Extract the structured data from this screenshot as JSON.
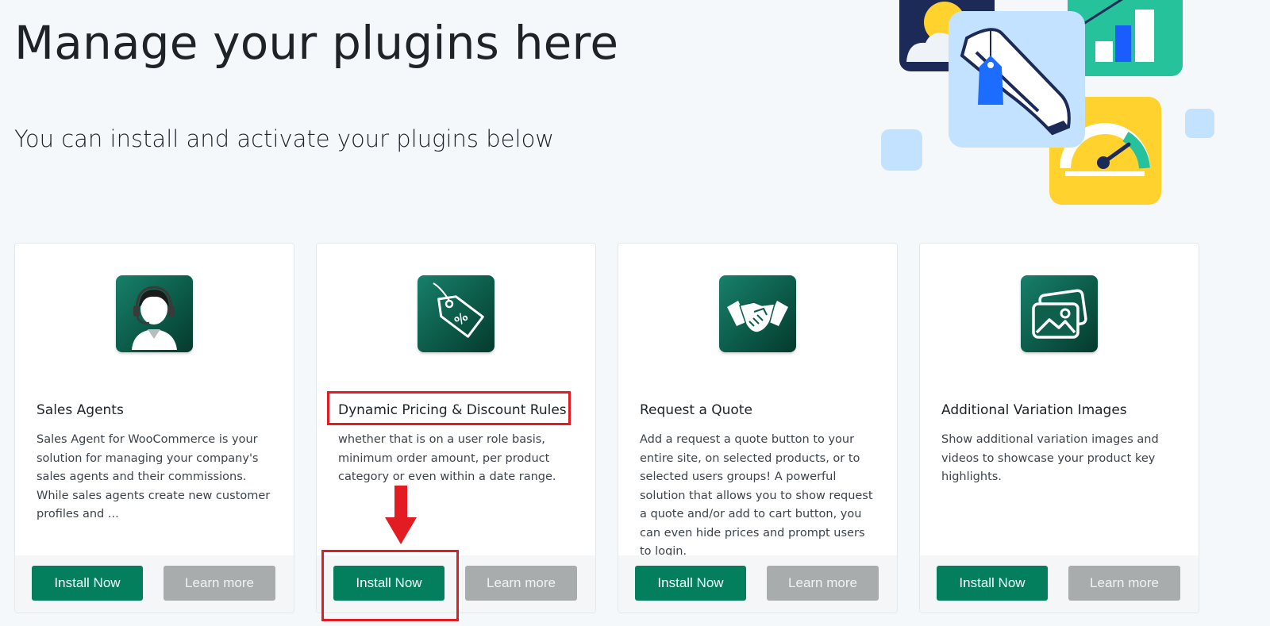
{
  "header": {
    "title": "Manage your plugins here",
    "subtitle": "You can install and activate your plugins below"
  },
  "colors": {
    "install_button": "#037f5e",
    "learn_button": "#a9acad",
    "highlight": "#e31b23",
    "icon_gradient_start": "#17806b",
    "icon_gradient_end": "#053a2e"
  },
  "plugins": [
    {
      "icon": "sales-agent-headset-icon",
      "title": "Sales Agents",
      "description": "Sales Agent for WooCommerce is your solution for managing your company's sales agents and their commissions. While sales agents create new customer profiles and ...",
      "install_label": "Install Now",
      "learn_label": "Learn more"
    },
    {
      "icon": "discount-tag-icon",
      "title": "Dynamic Pricing & Discount Rules",
      "description": "whether that is on a user role basis, minimum order amount, per product category or even within a date range.",
      "install_label": "Install Now",
      "learn_label": "Learn more"
    },
    {
      "icon": "handshake-icon",
      "title": "Request a Quote",
      "description": "Add a request a quote button to your entire site, on selected products, or to selected users groups! A powerful solution that allows you to show request a quote and/or add to cart button, you can even hide prices and prompt users to login.",
      "install_label": "Install Now",
      "learn_label": "Learn more"
    },
    {
      "icon": "images-gallery-icon",
      "title": "Additional Variation Images",
      "description": "Show additional variation images and videos to showcase your product key highlights.",
      "install_label": "Install Now",
      "learn_label": "Learn more"
    }
  ]
}
